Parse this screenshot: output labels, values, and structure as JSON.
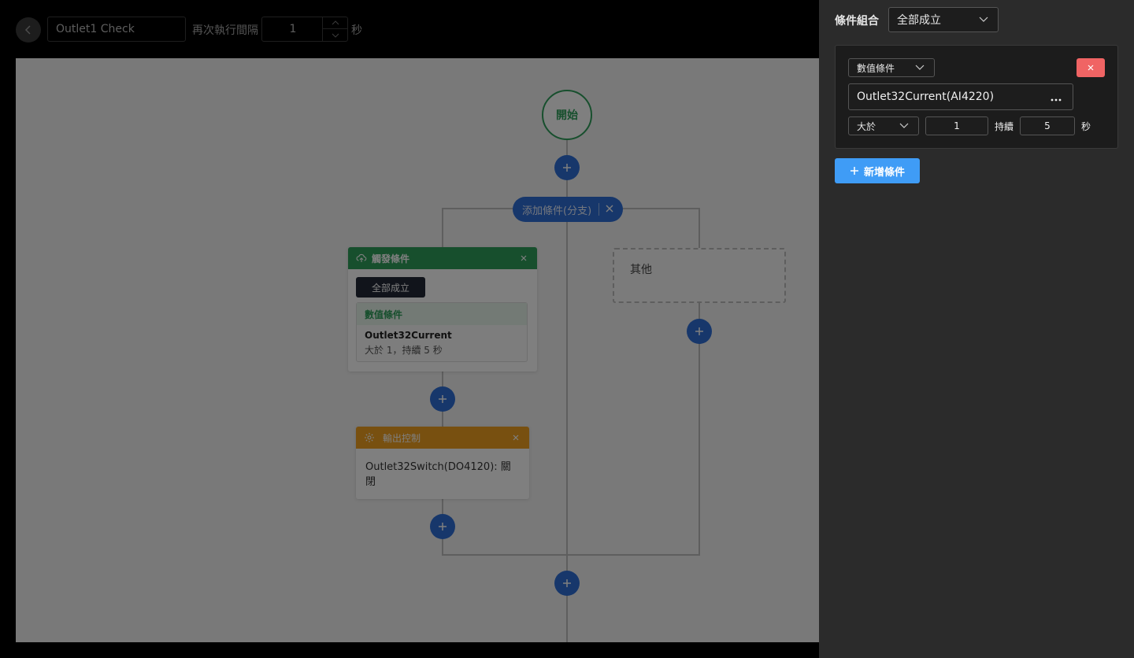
{
  "toolbar": {
    "rule_name": "Outlet1 Check",
    "interval_label": "再次執行間隔",
    "interval_value": "1",
    "interval_unit": "秒"
  },
  "flow": {
    "start_label": "開始",
    "branch_label": "添加條件(分支)",
    "trigger_card": {
      "title": "觸發條件",
      "combo": "全部成立",
      "condition_type": "數值條件",
      "condition_name": "Outlet32Current",
      "condition_desc": "大於 1，持續 5 秒"
    },
    "output_card": {
      "title": "輸出控制",
      "body": "Outlet32Switch(DO4120): 關閉"
    },
    "else_label": "其他"
  },
  "panel": {
    "combo_label": "條件組合",
    "combo_value": "全部成立",
    "condition": {
      "type": "數值條件",
      "sensor": "Outlet32Current(AI4220)",
      "operator": "大於",
      "threshold": "1",
      "duration_label": "持續",
      "duration": "5",
      "unit": "秒"
    },
    "add_button": "新增條件"
  },
  "colors": {
    "start_green": "#2e9e5b",
    "action_blue": "#2f6fd6",
    "output_orange": "#f0a020",
    "delete_red": "#f06464",
    "add_blue": "#3f9cf6"
  },
  "icons": [
    "chevron-left-icon",
    "chevron-up-icon",
    "chevron-down-icon",
    "plus-icon",
    "close-icon",
    "cloud-trigger-icon",
    "gear-icon",
    "more-icon"
  ]
}
